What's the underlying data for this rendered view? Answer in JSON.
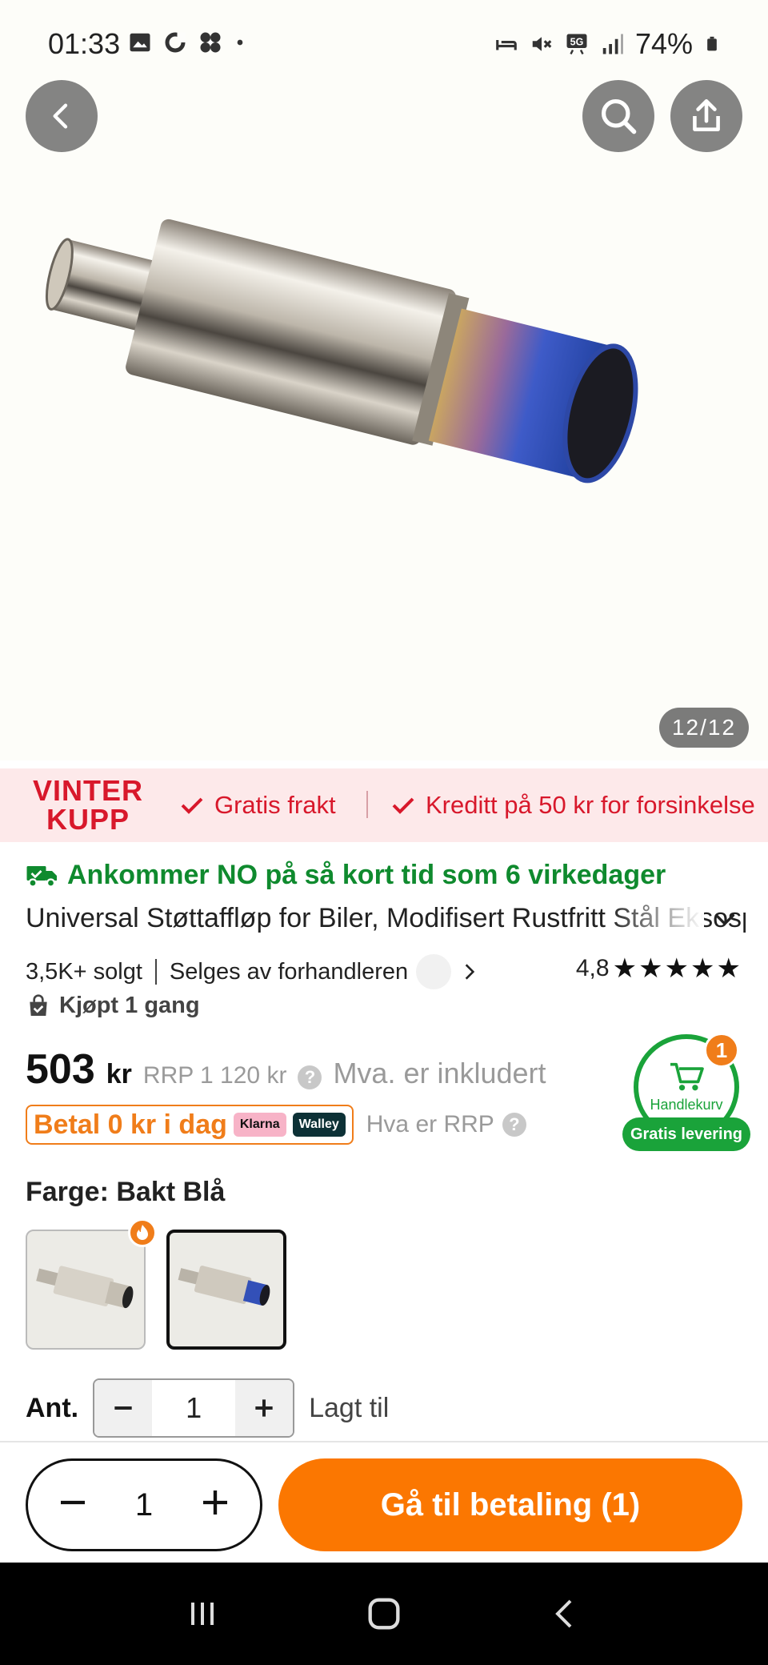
{
  "status_bar": {
    "time": "01:33",
    "battery": "74%",
    "network": "5G",
    "icons_left": [
      "image-icon",
      "sync-icon",
      "fan-icon",
      "dot-icon"
    ],
    "icons_right": [
      "sleep-icon",
      "mute-icon",
      "5g-icon",
      "signal-icon",
      "battery-icon"
    ]
  },
  "hero": {
    "image_counter": "12/12",
    "image_alt": "Stainless steel exhaust muffler with burnt blue tip"
  },
  "promo": {
    "logo_line1": "VINTER",
    "logo_line2": "KUPP",
    "item1": "Gratis frakt",
    "item2": "Kreditt på 50 kr for forsinkelse"
  },
  "product": {
    "delivery": "Ankommer NO på så kort tid som 6 virkedager",
    "title": "Universal Støttaffløp for Biler, Modifisert Rustfritt Stål Eksospotte",
    "sold": "3,5K+ solgt",
    "seller": "Selges av forhandleren",
    "rating": "4,8",
    "stars": "★★★★★",
    "bought": "Kjøpt 1 gang",
    "price": "503",
    "price_unit": "kr",
    "rrp": "RRP 1 120 kr",
    "vat": "Mva. er inkludert",
    "pay_today": "Betal 0 kr i dag",
    "klarna": "Klarna",
    "walley": "Walley",
    "rrp_help": "Hva er RRP",
    "color_label": "Farge: Bakt Blå",
    "qty_label": "Ant.",
    "qty_value": "1",
    "added": "Lagt til"
  },
  "cart_widget": {
    "count": "1",
    "label": "Handlekurv",
    "free_delivery": "Gratis levering"
  },
  "bottom_bar": {
    "qty": "1",
    "checkout": "Gå til betaling (1)"
  },
  "colors": {
    "accent_orange": "#fb7701",
    "promo_red": "#d8182b",
    "delivery_green": "#0f8a2e",
    "cart_green": "#1aa33a"
  }
}
